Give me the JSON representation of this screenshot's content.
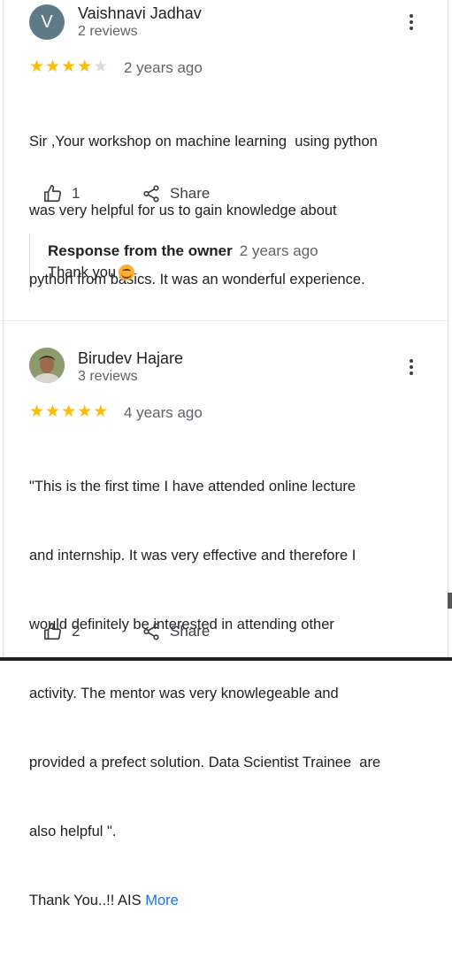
{
  "reviews": [
    {
      "avatar_letter": "V",
      "author": "Vaishnavi Jadhav",
      "review_count": "2 reviews",
      "rating": 4,
      "date": "2 years ago",
      "text_lines": [
        "Sir ,Your workshop on machine learning  using python",
        "was very helpful for us to gain knowledge about",
        "python from basics. It was an wonderful experience."
      ],
      "like_count": "1",
      "share_label": "Share",
      "owner_response": {
        "label": "Response from the owner",
        "date": "2 years ago",
        "text": "Thank you"
      }
    },
    {
      "author": "Birudev Hajare",
      "review_count": "3 reviews",
      "rating": 5,
      "date": "4 years ago",
      "text_lines": [
        "\"This is the first time I have attended online lecture",
        "and internship. It was very effective and therefore I",
        "would definitely be interested in attending other",
        "activity. The mentor was very knowlegeable and",
        "provided a prefect solution. Data Scientist Trainee  are",
        "also helpful \".",
        "Thank You..!! AIS"
      ],
      "more_label": "More",
      "like_count": "2",
      "share_label": "Share"
    }
  ],
  "colors": {
    "star": "#fbbc04",
    "link": "#1a73e8",
    "secondary_text": "#5f6368"
  },
  "icons": [
    "thumbs-up-icon",
    "share-icon",
    "more-vert-icon",
    "star-icon"
  ]
}
